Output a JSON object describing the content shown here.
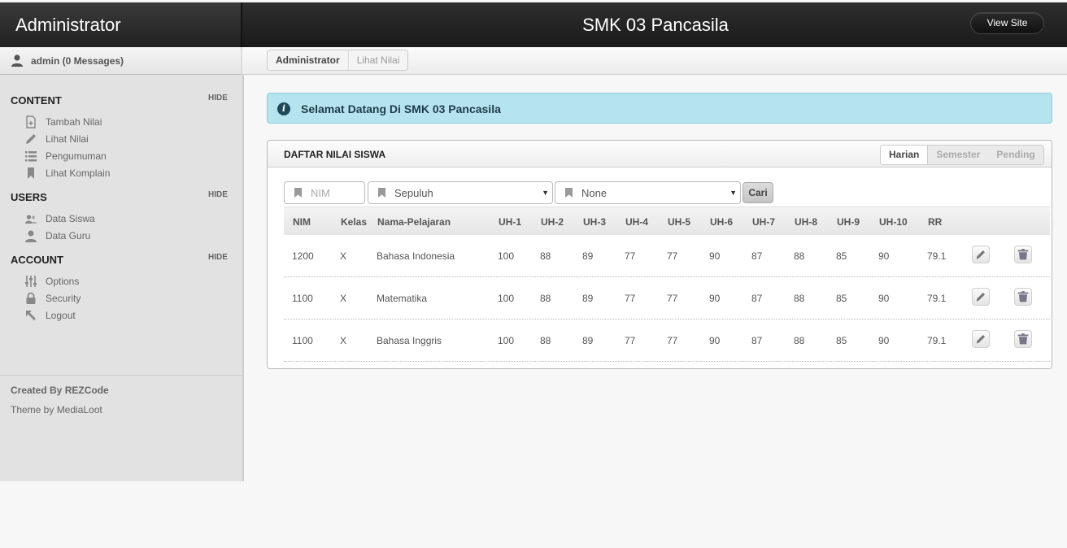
{
  "header": {
    "brand": "Administrator",
    "site_title": "SMK 03 Pancasila",
    "view_site": "View Site"
  },
  "user": {
    "label": "admin (0 Messages)",
    "icon": "user-icon"
  },
  "breadcrumbs": [
    "Administrator",
    "Lihat Nilai"
  ],
  "sidebar": {
    "sections": [
      {
        "title": "CONTENT",
        "hide": "HIDE",
        "items": [
          {
            "label": "Tambah Nilai",
            "icon": "add-document-icon"
          },
          {
            "label": "Lihat Nilai",
            "icon": "pencil-icon"
          },
          {
            "label": "Pengumuman",
            "icon": "list-icon"
          },
          {
            "label": "Lihat Komplain",
            "icon": "bookmark-icon"
          }
        ]
      },
      {
        "title": "USERS",
        "hide": "HIDE",
        "items": [
          {
            "label": "Data Siswa",
            "icon": "users-icon"
          },
          {
            "label": "Data Guru",
            "icon": "user-icon"
          }
        ]
      },
      {
        "title": "ACCOUNT",
        "hide": "HIDE",
        "items": [
          {
            "label": "Options",
            "icon": "sliders-icon"
          },
          {
            "label": "Security",
            "icon": "lock-icon"
          },
          {
            "label": "Logout",
            "icon": "logout-arrow-icon"
          }
        ]
      }
    ],
    "footer": {
      "created": "Created By REZCode",
      "theme": "Theme by MediaLoot"
    }
  },
  "alert": {
    "icon": "info-icon",
    "text": "Selamat Datang Di SMK 03 Pancasila",
    "color": "#b5e4ee"
  },
  "module": {
    "title": "DAFTAR NILAI SISWA",
    "tabs": [
      "Harian",
      "Semester",
      "Pending"
    ],
    "active_tab": "Harian",
    "filters": {
      "nim_placeholder": "NIM",
      "kelas_value": "Sepuluh",
      "pelajaran_value": "None",
      "search_button": "Cari"
    },
    "table": {
      "headers": [
        "NIM",
        "Kelas",
        "Nama-Pelajaran",
        "UH-1",
        "UH-2",
        "UH-3",
        "UH-4",
        "UH-5",
        "UH-6",
        "UH-7",
        "UH-8",
        "UH-9",
        "UH-10",
        "RR"
      ],
      "rows": [
        [
          "1200",
          "X",
          "Bahasa Indonesia",
          "100",
          "88",
          "89",
          "77",
          "77",
          "90",
          "87",
          "88",
          "85",
          "90",
          "79.1"
        ],
        [
          "1100",
          "X",
          "Matematika",
          "100",
          "88",
          "89",
          "77",
          "77",
          "90",
          "87",
          "88",
          "85",
          "90",
          "79.1"
        ],
        [
          "1100",
          "X",
          "Bahasa Inggris",
          "100",
          "88",
          "89",
          "77",
          "77",
          "90",
          "87",
          "88",
          "85",
          "90",
          "79.1"
        ]
      ],
      "row_actions": [
        "edit-icon",
        "trash-icon"
      ]
    }
  }
}
